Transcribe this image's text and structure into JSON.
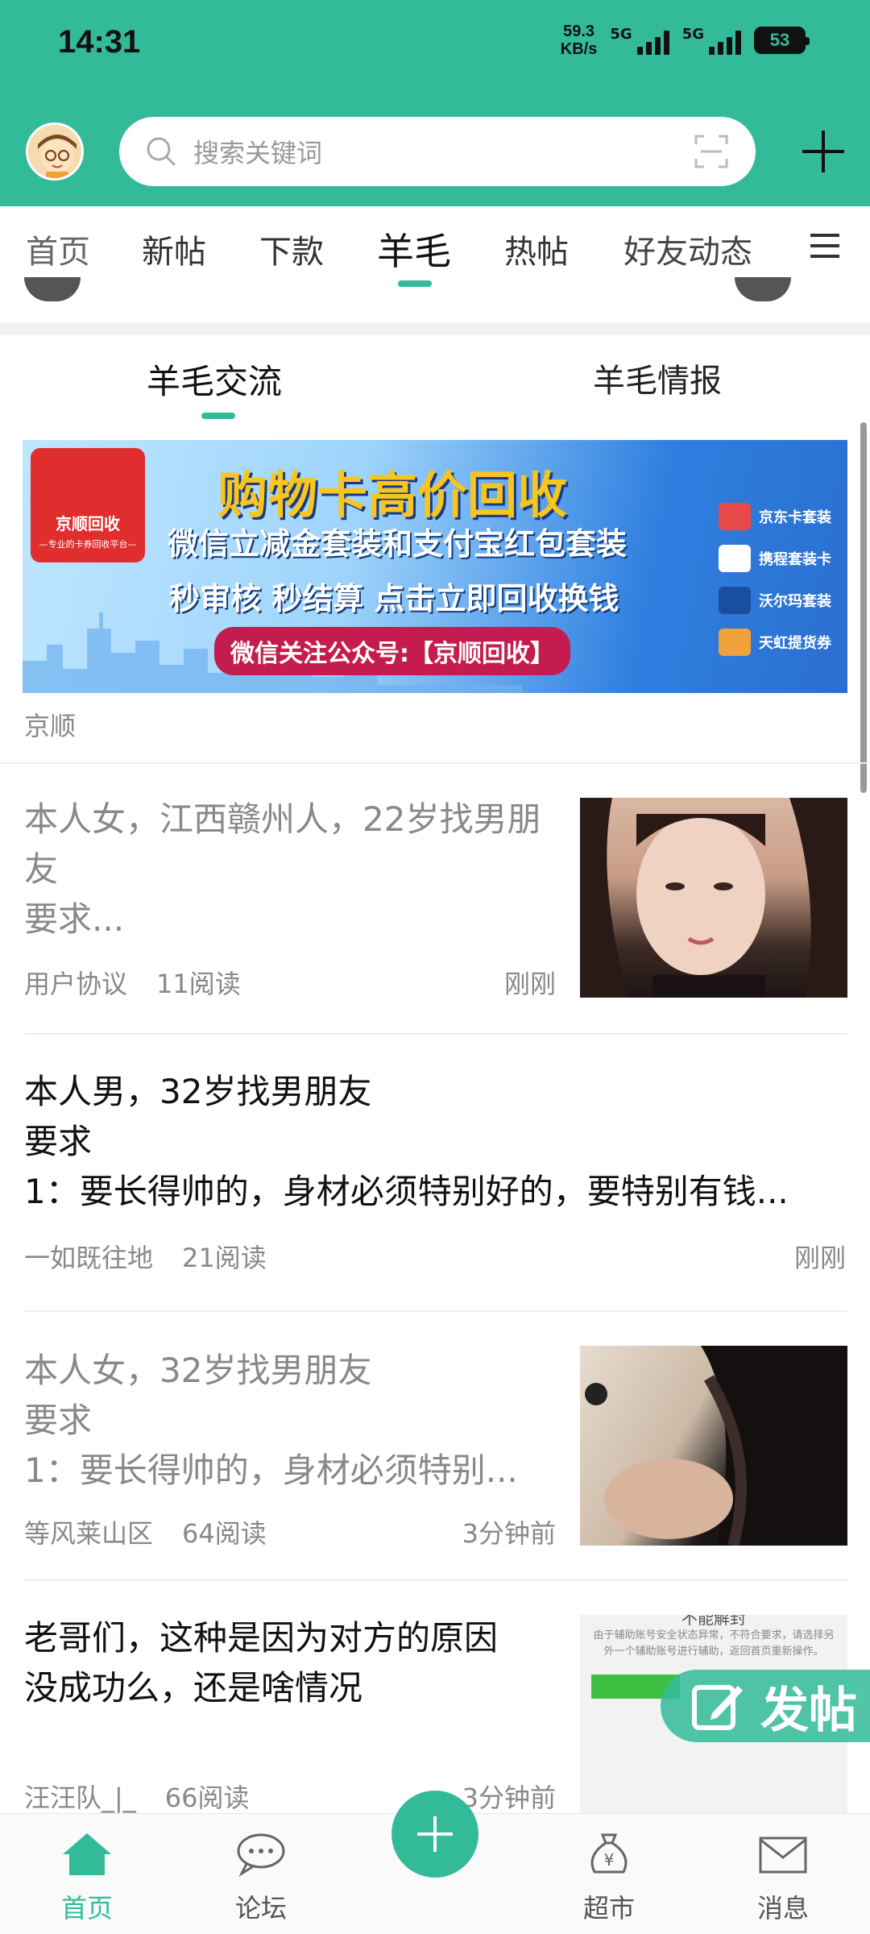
{
  "status_bar": {
    "time": "14:31",
    "net_speed_value": "59.3",
    "net_speed_unit": "KB/s",
    "sim1": "5G",
    "sim2": "5G",
    "battery": "53"
  },
  "search": {
    "placeholder": "搜索关键词"
  },
  "tabs": [
    {
      "label": "首页"
    },
    {
      "label": "新帖"
    },
    {
      "label": "下款"
    },
    {
      "label": "羊毛",
      "active": true
    },
    {
      "label": "热帖"
    },
    {
      "label": "好友动态"
    }
  ],
  "subtabs": [
    {
      "label": "羊毛交流",
      "active": true
    },
    {
      "label": "羊毛情报"
    }
  ],
  "banner": {
    "logo_name": "京顺回收",
    "logo_sub": "—专业的卡券回收平台—",
    "headline": "购物卡高价回收",
    "line1": "微信立减金套装和支付宝红包套装",
    "line2": "秒审核 秒结算 点击立即回收换钱",
    "cta": "微信关注公众号:【京顺回收】",
    "side_items": [
      "京东卡套装",
      "携程套装卡",
      "沃尔玛套装",
      "天虹提货券"
    ],
    "source": "京顺"
  },
  "posts": [
    {
      "title_line1": "本人女，江西赣州人，22岁找男朋",
      "title_line2": "友",
      "title_line3": "要求...",
      "author": "用户协议",
      "reads": "11阅读",
      "time": "刚刚"
    },
    {
      "title_line1": "本人男，32岁找男朋友",
      "title_line2": "要求",
      "title_line3": "1：要长得帅的，身材必须特别好的，要特别有钱...",
      "author": "一如既往地",
      "reads": "21阅读",
      "time": "刚刚"
    },
    {
      "title_line1": "本人女，32岁找男朋友",
      "title_line2": "要求",
      "title_line3": "1：要长得帅的，身材必须特别...",
      "author": "等风莱山区",
      "reads": "64阅读",
      "time": "3分钟前"
    },
    {
      "title_line1": "老哥们，这种是因为对方的原因",
      "title_line2": "没成功么，还是啥情况",
      "author": "汪汪队_|_",
      "reads": "66阅读",
      "time": "3分钟前",
      "thumb_heading": "不能解封",
      "thumb_text": "由于辅助账号安全状态异常，不符合要求，请选择另外一个辅助账号进行辅助，返回首页重新操作。"
    }
  ],
  "fab": {
    "label": "发帖"
  },
  "bottom_nav": [
    {
      "label": "首页",
      "icon": "home-icon",
      "active": true
    },
    {
      "label": "论坛",
      "icon": "chat-icon"
    },
    {
      "label": "",
      "icon": "plus-icon"
    },
    {
      "label": "超市",
      "icon": "money-bag-icon"
    },
    {
      "label": "消息",
      "icon": "mail-icon"
    }
  ],
  "colors": {
    "accent": "#33bb99",
    "read_text": "#888888"
  }
}
